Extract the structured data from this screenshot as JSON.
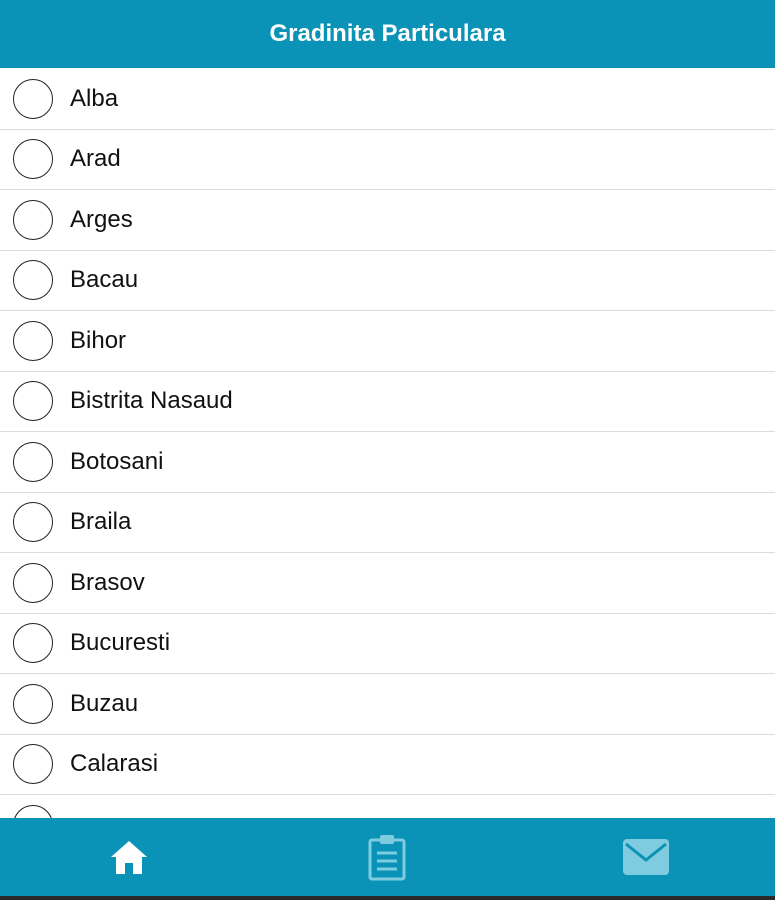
{
  "header": {
    "title": "Gradinita Particulara"
  },
  "counties": [
    {
      "label": "Alba"
    },
    {
      "label": "Arad"
    },
    {
      "label": "Arges"
    },
    {
      "label": "Bacau"
    },
    {
      "label": "Bihor"
    },
    {
      "label": "Bistrita Nasaud"
    },
    {
      "label": "Botosani"
    },
    {
      "label": "Braila"
    },
    {
      "label": "Brasov"
    },
    {
      "label": "Bucuresti"
    },
    {
      "label": "Buzau"
    },
    {
      "label": "Calarasi"
    }
  ],
  "tabbar": {
    "tabs": [
      {
        "icon": "home-icon",
        "active": true
      },
      {
        "icon": "clipboard-icon",
        "active": false
      },
      {
        "icon": "mail-icon",
        "active": false
      }
    ]
  },
  "colors": {
    "accent": "#0a93b7",
    "active_icon": "#ffffff",
    "inactive_icon": "#7fcbe0"
  }
}
